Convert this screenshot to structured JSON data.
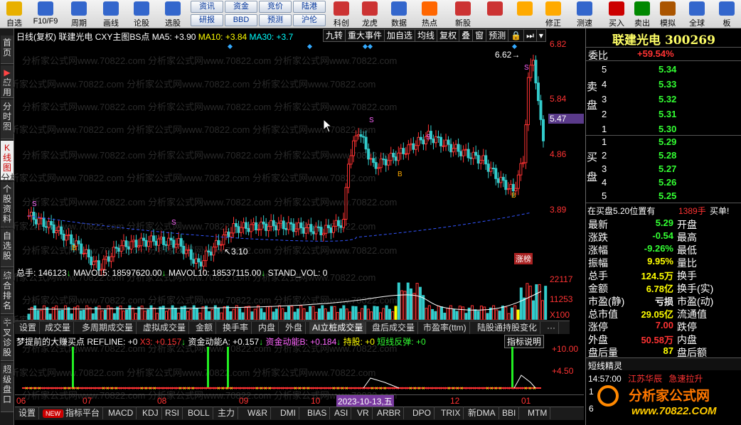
{
  "toolbar": {
    "buttons": [
      {
        "label": "自选",
        "icon": "star-icon",
        "color": "#e8b000"
      },
      {
        "label": "F10/F9",
        "icon": "doc-icon",
        "color": "#3366cc"
      },
      {
        "label": "周期",
        "icon": "calendar-icon",
        "color": "#3366cc"
      },
      {
        "label": "画线",
        "icon": "pen-icon",
        "color": "#3366cc"
      },
      {
        "label": "论股",
        "icon": "chat-icon",
        "color": "#3366cc"
      },
      {
        "label": "选股",
        "icon": "target-icon",
        "color": "#3366cc"
      },
      {
        "label": "科创",
        "icon": "sci-icon",
        "color": "#cc3333"
      },
      {
        "label": "龙虎",
        "icon": "dragon-icon",
        "color": "#cc3333"
      },
      {
        "label": "数据",
        "icon": "pe-icon",
        "color": "#3366cc"
      },
      {
        "label": "热点",
        "icon": "hot-icon",
        "color": "#ff6600"
      },
      {
        "label": "新股",
        "icon": "newstock-icon",
        "color": "#cc3333"
      },
      {
        "label": "",
        "icon": "grid-icon",
        "color": "#cc3333"
      },
      {
        "label": "",
        "icon": "back-arrow-icon",
        "color": "#ffaa00"
      },
      {
        "label": "修正",
        "icon": "updown-icon",
        "color": "#ffaa00"
      },
      {
        "label": "测速",
        "icon": "speed-icon",
        "color": "#3366cc"
      },
      {
        "label": "买入",
        "icon": "buy-icon",
        "color": "#cc0000"
      },
      {
        "label": "卖出",
        "icon": "sell-icon",
        "color": "#008800"
      },
      {
        "label": "模拟",
        "icon": "hammer-icon",
        "color": "#aa5500"
      },
      {
        "label": "全球",
        "icon": "globe-icon",
        "color": "#3366cc"
      },
      {
        "label": "板",
        "icon": "board-icon",
        "color": "#3366cc"
      }
    ],
    "small_buttons": [
      "资讯",
      "资金",
      "竞价",
      "陆港",
      "研报",
      "BBD",
      "预测",
      "沪伦"
    ]
  },
  "side_tabs": [
    "首页",
    "应用",
    "分时图",
    "K线图",
    "个股资料",
    "自选股",
    "综合排名",
    "牛叉诊股",
    "超级盘口"
  ],
  "chart": {
    "header": {
      "period": "日线(复权)",
      "stock": "联建光电",
      "indicator": "CXY主图BS点",
      "ma5": "MA5: +3.90",
      "ma10": "MA10: +3.84",
      "ma30": "MA30: +3.7",
      "buttons": [
        "九转",
        "重大事件",
        "加自选",
        "均线",
        "复权",
        "叠",
        "窗",
        "预测"
      ]
    },
    "price_axis": [
      "6.82",
      "5.84",
      "5.47",
      "4.86",
      "3.89"
    ],
    "annotations": {
      "high": "6.62",
      "low": "3.10",
      "limit_up": "涨榜"
    },
    "volume_header": {
      "total": "总手: 146123",
      "mavol5": "MAVOL5: 18597620.00",
      "mavol10": "MAVOL10: 18537115.00",
      "stand": "STAND_VOL: 0"
    },
    "volume_axis": [
      "22117",
      "11253",
      "X100"
    ],
    "indicator_tabs": [
      "设置",
      "成交量",
      "多周期成交量",
      "虚拟成交量",
      "金额",
      "换手率",
      "内盘",
      "外盘",
      "AI立桩成交量",
      "盘后成交量",
      "市盈率(ttm)",
      "陆股通持股变化",
      "···"
    ],
    "lower_header": {
      "name": "梦提前的大赚买点",
      "refline": "REFLINE: +0",
      "x3": "X3: +0.157",
      "fund_a": "资金动能A: +0.157",
      "fund_b": "资金动能B: +0.184",
      "hold": "持股: +0",
      "short": "短线反弹: +0",
      "desc_btn": "指标说明"
    },
    "lower_axis": [
      "+10.00",
      "+4.50"
    ],
    "date_axis": [
      "06",
      "07",
      "08",
      "09",
      "10",
      "2023-10-13,五",
      "12",
      "01"
    ],
    "bottom_tabs": [
      "设置",
      "NEW",
      "指标平台",
      "MACD",
      "KDJ",
      "RSI",
      "BOLL",
      "主力",
      "W&R",
      "DMI",
      "BIAS",
      "ASI",
      "VR",
      "ARBR",
      "DPO",
      "TRIX",
      "新DMA",
      "BBI",
      "MTM"
    ],
    "watermark": "分析家公式网www.70822.com"
  },
  "quote": {
    "title": "联建光电 300269",
    "weibi_label": "委比",
    "weibi_value": "+59.54%",
    "sell_label": "卖盘",
    "buy_label": "买盘",
    "sell": [
      {
        "level": "5",
        "price": "5.34"
      },
      {
        "level": "4",
        "price": "5.33"
      },
      {
        "level": "3",
        "price": "5.32"
      },
      {
        "level": "2",
        "price": "5.31"
      },
      {
        "level": "1",
        "price": "5.30"
      }
    ],
    "buy": [
      {
        "level": "1",
        "price": "5.29"
      },
      {
        "level": "2",
        "price": "5.28"
      },
      {
        "level": "3",
        "price": "5.27"
      },
      {
        "level": "4",
        "price": "5.26"
      },
      {
        "level": "5",
        "price": "5.25"
      }
    ],
    "notice": {
      "text": "在买盘5.20位置有",
      "qty": "1389手",
      "action": "买单!"
    },
    "stats": [
      {
        "l": "最新",
        "v": "5.29",
        "c": "green",
        "r": "开盘"
      },
      {
        "l": "涨跌",
        "v": "-0.54",
        "c": "green",
        "r": "最高"
      },
      {
        "l": "涨幅",
        "v": "-9.26%",
        "c": "green",
        "r": "最低"
      },
      {
        "l": "振幅",
        "v": "9.95%",
        "c": "yellow",
        "r": "量比"
      },
      {
        "l": "总手",
        "v": "124.5万",
        "c": "yellow",
        "r": "换手"
      },
      {
        "l": "金额",
        "v": "6.78亿",
        "c": "yellow",
        "r": "换手(实)"
      },
      {
        "l": "市盈(静)",
        "v": "亏损",
        "c": "white",
        "r": "市盈(动)"
      },
      {
        "l": "总市值",
        "v": "29.05亿",
        "c": "yellow",
        "r": "流通值"
      },
      {
        "l": "涨停",
        "v": "7.00",
        "c": "red",
        "r": "跌停"
      },
      {
        "l": "外盘",
        "v": "50.58万",
        "c": "red",
        "r": "内盘"
      },
      {
        "l": "盘后量",
        "v": "87",
        "c": "yellow",
        "r": "盘后额"
      }
    ],
    "short_title": "短线精灵",
    "short_item": {
      "time": "14:57:00",
      "name": "江苏华辰",
      "event": "急速拉升"
    },
    "short_nums": [
      "1",
      "6"
    ],
    "logo_text": "分析家公式网",
    "logo_url": "www.70822.COM"
  },
  "colors": {
    "up": "#ff3333",
    "down": "#33cccc",
    "bg": "#000000"
  }
}
